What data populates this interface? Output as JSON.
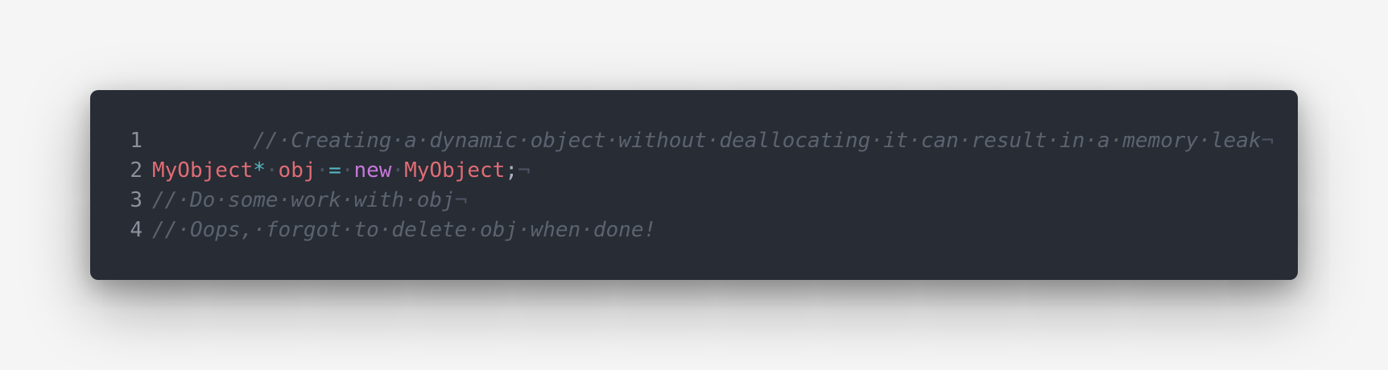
{
  "editor": {
    "lines": [
      {
        "number": "1",
        "tokens": [
          {
            "type": "comment",
            "text": "//·Creating·a·dynamic·object·without·deallocating·it·can·result·in·a·memory·leak"
          },
          {
            "type": "ws",
            "text": "¬"
          }
        ]
      },
      {
        "number": "2",
        "tokens": [
          {
            "type": "type",
            "text": "MyObject"
          },
          {
            "type": "op",
            "text": "*"
          },
          {
            "type": "ws",
            "text": "·"
          },
          {
            "type": "var",
            "text": "obj"
          },
          {
            "type": "ws",
            "text": "·"
          },
          {
            "type": "op",
            "text": "="
          },
          {
            "type": "ws",
            "text": "·"
          },
          {
            "type": "keyword",
            "text": "new"
          },
          {
            "type": "ws",
            "text": "·"
          },
          {
            "type": "type",
            "text": "MyObject"
          },
          {
            "type": "punct",
            "text": ";"
          },
          {
            "type": "ws",
            "text": "¬"
          }
        ]
      },
      {
        "number": "3",
        "tokens": [
          {
            "type": "comment",
            "text": "//·Do·some·work·with·obj"
          },
          {
            "type": "ws",
            "text": "¬"
          }
        ]
      },
      {
        "number": "4",
        "tokens": [
          {
            "type": "comment",
            "text": "//·Oops,·forgot·to·delete·obj·when·done!"
          }
        ]
      }
    ]
  },
  "colors": {
    "background": "#282c34",
    "comment": "#5c6370",
    "type": "#e06c75",
    "operator": "#56b6c2",
    "keyword": "#c678dd",
    "line_number": "#8b919d"
  }
}
